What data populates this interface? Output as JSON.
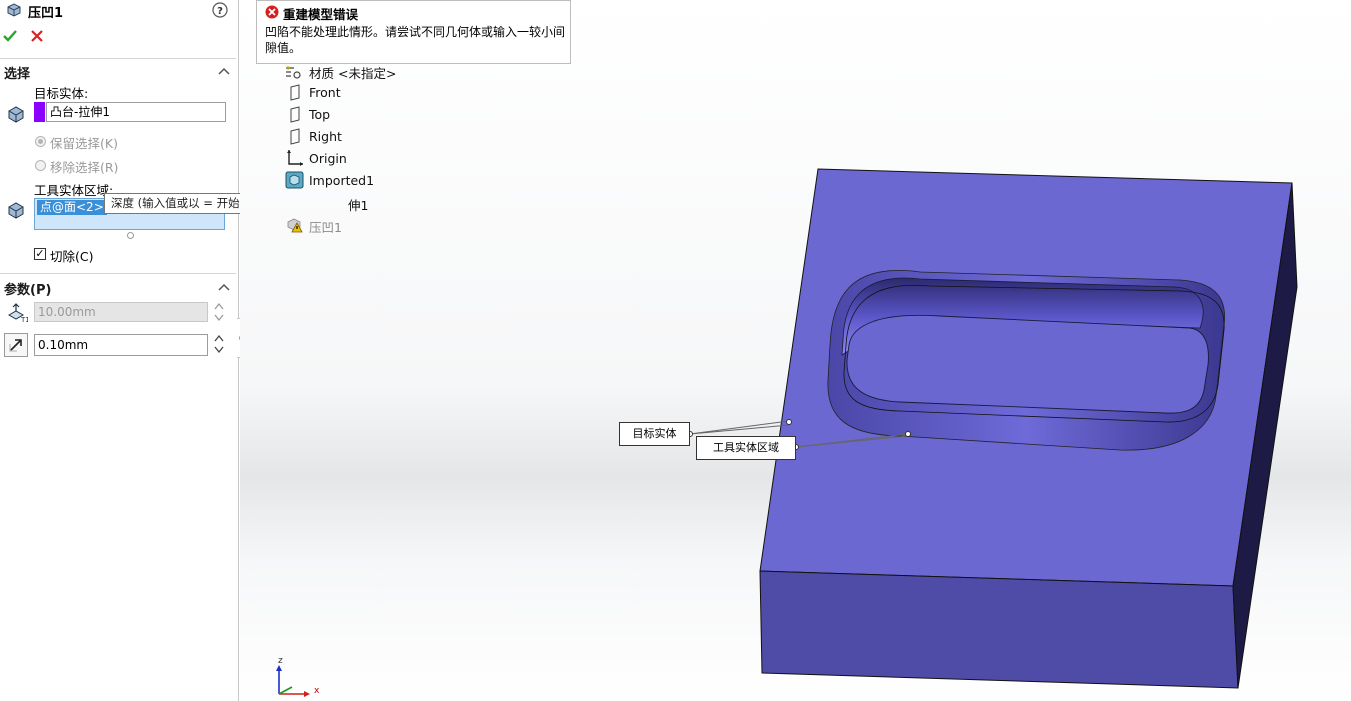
{
  "property_manager": {
    "title": "压凹1",
    "icons": {
      "feature": "indent-feature-icon",
      "help": "help-icon",
      "ok": "checkmark-icon",
      "cancel": "close-icon"
    },
    "selection": {
      "header": "选择",
      "target_label": "目标实体:",
      "target_value": "凸台-拉伸1",
      "target_color": "#8B00FF",
      "keep_selection": "保留选择(K)",
      "remove_selection": "移除选择(R)",
      "tool_label": "工具实体区域:",
      "tool_value": "点@面<2>",
      "cut_label": "切除(C)",
      "cut_checked": true
    },
    "tooltip": "深度  (输入值或以 = 开始，以创建方程式)",
    "parameters": {
      "header": "参数(P)",
      "thickness_value": "10.00mm",
      "clearance_value": "0.10mm"
    }
  },
  "error_balloon": {
    "title": "重建模型错误",
    "message": "凹陷不能处理此情形。请尝试不同几何体或输入一较小间隙值。"
  },
  "feature_tree": {
    "items": [
      {
        "label": "材质 <未指定>",
        "icon": "material-icon"
      },
      {
        "label": "Front",
        "icon": "plane-icon"
      },
      {
        "label": "Top",
        "icon": "plane-icon"
      },
      {
        "label": "Right",
        "icon": "plane-icon"
      },
      {
        "label": "Origin",
        "icon": "origin-icon"
      },
      {
        "label": "Imported1",
        "icon": "imported-body-icon"
      },
      {
        "label": "伸1",
        "icon": "extrude-icon"
      },
      {
        "label": "压凹1",
        "icon": "warning-indent-icon"
      }
    ]
  },
  "viewport": {
    "callout_target": "目标实体",
    "callout_tool": "工具实体区域",
    "triad_z": "z",
    "triad_x": "x",
    "body_color": "#6B68D1"
  }
}
